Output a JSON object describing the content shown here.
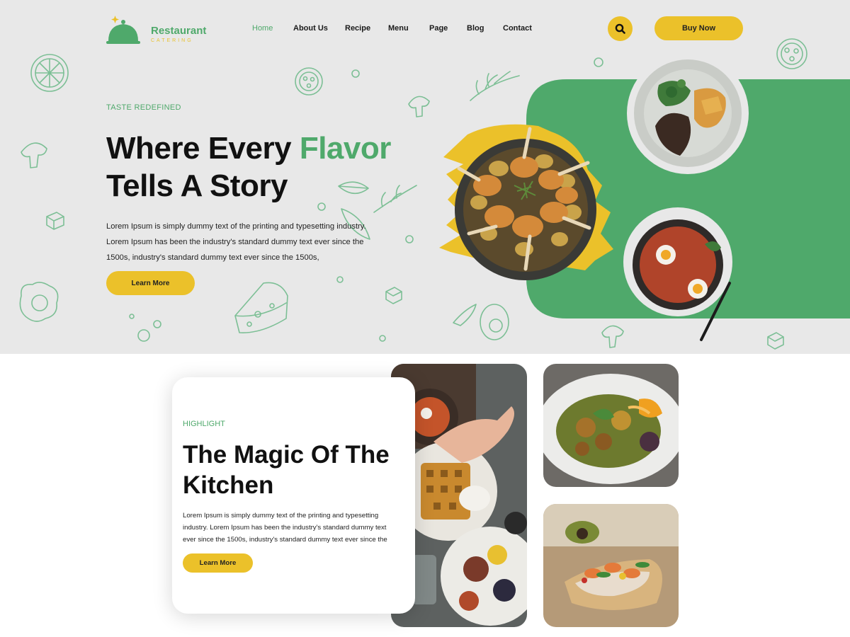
{
  "brand": {
    "name": "Restaurant",
    "tagline": "CATERING"
  },
  "nav": {
    "items": [
      {
        "label": "Home",
        "active": true
      },
      {
        "label": "About Us",
        "active": false
      },
      {
        "label": "Recipe",
        "active": false
      },
      {
        "label": "Menu",
        "active": false
      },
      {
        "label": "Page",
        "active": false
      },
      {
        "label": "Blog",
        "active": false
      },
      {
        "label": "Contact",
        "active": false
      }
    ],
    "search_icon": "search-icon",
    "buy_label": "Buy Now"
  },
  "hero": {
    "eyebrow": "TASTE REDEFINED",
    "title_part1": "Where Every ",
    "title_accent": "Flavor",
    "title_line2": "Tells A Story",
    "text": "Lorem Ipsum is simply dummy text of the printing and typesetting industry. Lorem Ipsum has been the industry's standard dummy text ever since the 1500s, industry's standard dummy text ever since the 1500s,",
    "button": "Learn More"
  },
  "highlight": {
    "eyebrow": "HIGHLIGHT",
    "title": "The Magic Of The Kitchen",
    "text": "Lorem Ipsum is simply dummy text of the printing and typesetting industry. Lorem Ipsum has been the industry's standard dummy text ever since the 1500s, industry's standard dummy text ever since the",
    "button": "Learn More"
  },
  "colors": {
    "accent_green": "#4fa96b",
    "accent_yellow": "#ebc12a",
    "hero_background": "#e8e8e8",
    "text_dark": "#111111"
  }
}
